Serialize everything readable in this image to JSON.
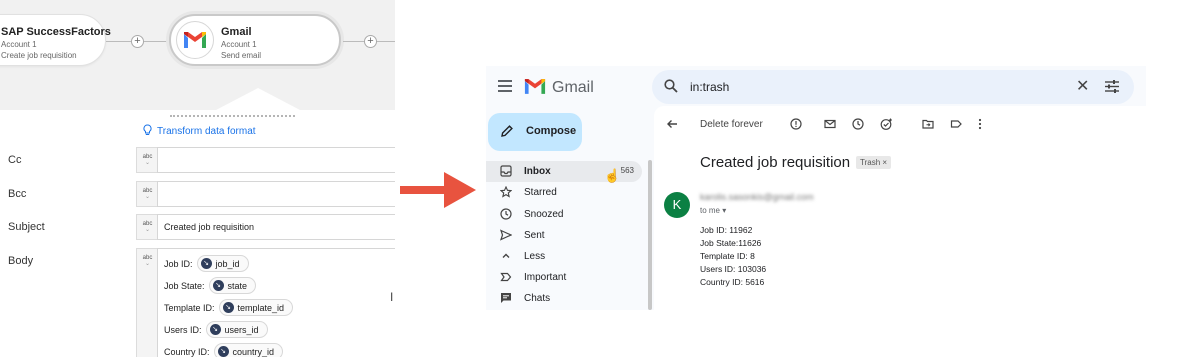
{
  "workflow": {
    "node_prev": {
      "title": "SAP SuccessFactors",
      "subtitle": "Account 1",
      "action": "Create job requisition"
    },
    "node_gmail": {
      "title": "Gmail",
      "subtitle": "Account 1",
      "action": "Send email"
    }
  },
  "form": {
    "transform_link": "Transform data format",
    "type_badge": "abc",
    "cc_label": "Cc",
    "bcc_label": "Bcc",
    "subject_label": "Subject",
    "subject_value": "Created job requisition",
    "body_label": "Body",
    "body_lines": [
      {
        "label": "Job ID:",
        "chip": "job_id"
      },
      {
        "label": "Job State:",
        "chip": "state"
      },
      {
        "label": "Template ID:",
        "chip": "template_id"
      },
      {
        "label": "Users ID:",
        "chip": "users_id"
      },
      {
        "label": "Country ID:",
        "chip": "country_id"
      }
    ]
  },
  "gmail": {
    "app_name": "Gmail",
    "search_query": "in:trash",
    "compose_label": "Compose",
    "nav": [
      {
        "label": "Inbox",
        "count": "563",
        "icon": "inbox-icon"
      },
      {
        "label": "Starred",
        "icon": "star-icon"
      },
      {
        "label": "Snoozed",
        "icon": "clock-icon"
      },
      {
        "label": "Sent",
        "icon": "send-icon"
      },
      {
        "label": "Less",
        "icon": "chevron-up-icon"
      },
      {
        "label": "Important",
        "icon": "important-icon"
      },
      {
        "label": "Chats",
        "icon": "chat-icon"
      }
    ],
    "toolbar": {
      "delete_forever": "Delete forever"
    },
    "email": {
      "subject": "Created job requisition",
      "label_badge": "Trash ×",
      "avatar_letter": "K",
      "sender": "karolis.sasonkis@gmail.com",
      "to": "to me",
      "body": [
        "Job ID: 11962",
        "Job State:11626",
        "Template ID: 8",
        "Users ID: 103036",
        "Country ID: 5616"
      ]
    }
  },
  "colors": {
    "arrow": "#e8533f",
    "compose_bg": "#c2e7ff",
    "avatar_bg": "#0b8043",
    "link": "#1a73e8"
  }
}
